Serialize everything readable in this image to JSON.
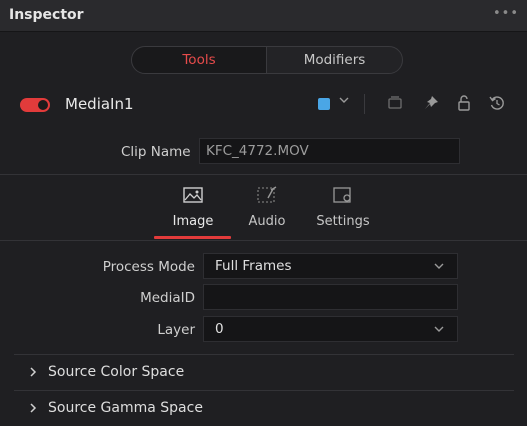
{
  "window": {
    "title": "Inspector",
    "more": "•••"
  },
  "top_tabs": [
    {
      "label": "Tools"
    },
    {
      "label": "Modifiers"
    }
  ],
  "node": {
    "name": "MediaIn1",
    "color": "#4aa6e6"
  },
  "clip": {
    "label": "Clip Name",
    "value": "KFC_4772.MOV"
  },
  "inner_tabs": [
    {
      "label": "Image",
      "icon": "image-icon"
    },
    {
      "label": "Audio",
      "icon": "audio-icon"
    },
    {
      "label": "Settings",
      "icon": "settings-icon"
    }
  ],
  "fields": {
    "process_mode": {
      "label": "Process Mode",
      "value": "Full Frames"
    },
    "media_id": {
      "label": "MediaID",
      "value": ""
    },
    "layer": {
      "label": "Layer",
      "value": "0"
    }
  },
  "sections": [
    {
      "title": "Source Color Space"
    },
    {
      "title": "Source Gamma Space"
    }
  ]
}
